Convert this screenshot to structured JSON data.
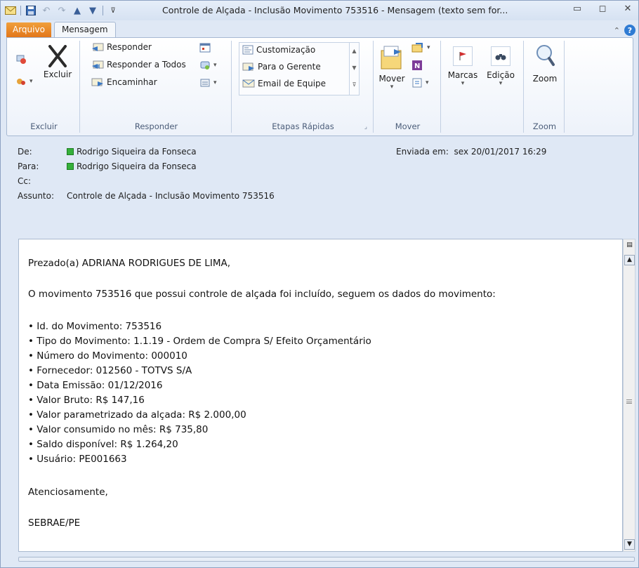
{
  "window": {
    "title": "Controle de Alçada - Inclusão Movimento 753516  -  Mensagem (texto sem for...",
    "minimize": "▭",
    "maximize": "◻",
    "close": "✕"
  },
  "tabs": {
    "file": "Arquivo",
    "message": "Mensagem"
  },
  "ribbon": {
    "excluir_group": {
      "delete_label": "Excluir",
      "group_label": "Excluir"
    },
    "responder_group": {
      "reply": "Responder",
      "reply_all": "Responder a Todos",
      "forward": "Encaminhar",
      "group_label": "Responder"
    },
    "etapas_group": {
      "items": [
        "Customização",
        "Para o Gerente",
        "Email de Equipe"
      ],
      "group_label": "Etapas Rápidas"
    },
    "mover_group": {
      "move_label": "Mover",
      "group_label": "Mover"
    },
    "marcas_label": "Marcas",
    "edicao_label": "Edição",
    "zoom_group": {
      "zoom_label": "Zoom",
      "group_label": "Zoom"
    }
  },
  "message": {
    "from_label": "De:",
    "from": "Rodrigo Siqueira da Fonseca",
    "to_label": "Para:",
    "to": "Rodrigo Siqueira da Fonseca",
    "cc_label": "Cc:",
    "subject_label": "Assunto:",
    "subject": "Controle de Alçada - Inclusão Movimento 753516",
    "sent_label": "Enviada em:",
    "sent": "sex 20/01/2017 16:29"
  },
  "body": {
    "greeting": "Prezado(a) ADRIANA RODRIGUES DE LIMA,",
    "intro": "O movimento 753516 que possui controle de alçada foi incluído, seguem os dados do movimento:",
    "items": [
      "• Id. do Movimento: 753516",
      "• Tipo do Movimento: 1.1.19 - Ordem de Compra S/ Efeito Orçamentário",
      "• Número do Movimento: 000010",
      "• Fornecedor: 012560 - TOTVS S/A",
      "• Data Emissão: 01/12/2016",
      "• Valor Bruto: R$ 147,16",
      "• Valor parametrizado da alçada: R$ 2.000,00",
      "• Valor consumido no mês:  R$ 735,80",
      "• Saldo disponível: R$ 1.264,20",
      "• Usuário: PE001663"
    ],
    "closing": "Atenciosamente,",
    "signature": "SEBRAE/PE"
  },
  "colors": {
    "file_tab": "#e2761a",
    "presence": "#35b03a",
    "ribbon_bg": "#edf2fa"
  }
}
